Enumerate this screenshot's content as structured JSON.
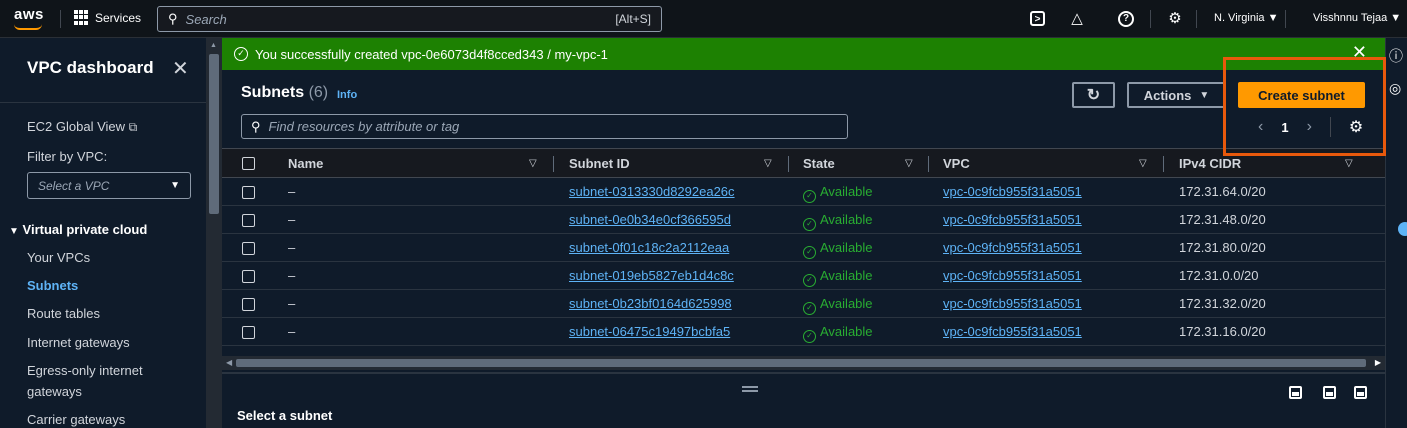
{
  "nav": {
    "logo": "aws",
    "services": "Services",
    "search_placeholder": "Search",
    "search_shortcut": "[Alt+S]",
    "region": "N. Virginia ▼",
    "user": "Visshnnu Tejaa ▼",
    "icons": [
      "cloudshell-icon",
      "bell-icon",
      "help-icon",
      "gear-icon"
    ]
  },
  "sidebar": {
    "title": "VPC dashboard",
    "ec2_global": "EC2 Global View",
    "filter_label": "Filter by VPC:",
    "filter_placeholder": "Select a VPC",
    "section": "Virtual private cloud",
    "items": [
      {
        "label": "Your VPCs",
        "active": false
      },
      {
        "label": "Subnets",
        "active": true
      },
      {
        "label": "Route tables",
        "active": false
      },
      {
        "label": "Internet gateways",
        "active": false
      },
      {
        "label": "Egress-only internet",
        "active": false
      },
      {
        "label": "gateways",
        "active": false
      },
      {
        "label": "Carrier gateways",
        "active": false
      }
    ]
  },
  "flash": {
    "message": "You successfully created vpc-0e6073d4f8cced343 / my-vpc-1",
    "color": "#1d8102"
  },
  "header": {
    "title": "Subnets",
    "count": "(6)",
    "info": "Info",
    "actions": "Actions",
    "create": "Create subnet",
    "filter_placeholder": "Find resources by attribute or tag",
    "page": "1"
  },
  "table": {
    "columns": [
      "Name",
      "Subnet ID",
      "State",
      "VPC",
      "IPv4 CIDR"
    ],
    "rows": [
      {
        "name": "–",
        "subnet_id": "subnet-0313330d8292ea26c",
        "state": "Available",
        "vpc": "vpc-0c9fcb955f31a5051",
        "cidr": "172.31.64.0/20"
      },
      {
        "name": "–",
        "subnet_id": "subnet-0e0b34e0cf366595d",
        "state": "Available",
        "vpc": "vpc-0c9fcb955f31a5051",
        "cidr": "172.31.48.0/20"
      },
      {
        "name": "–",
        "subnet_id": "subnet-0f01c18c2a2112eaa",
        "state": "Available",
        "vpc": "vpc-0c9fcb955f31a5051",
        "cidr": "172.31.80.0/20"
      },
      {
        "name": "–",
        "subnet_id": "subnet-019eb5827eb1d4c8c",
        "state": "Available",
        "vpc": "vpc-0c9fcb955f31a5051",
        "cidr": "172.31.0.0/20"
      },
      {
        "name": "–",
        "subnet_id": "subnet-0b23bf0164d625998",
        "state": "Available",
        "vpc": "vpc-0c9fcb955f31a5051",
        "cidr": "172.31.32.0/20"
      },
      {
        "name": "–",
        "subnet_id": "subnet-06475c19497bcbfa5",
        "state": "Available",
        "vpc": "vpc-0c9fcb955f31a5051",
        "cidr": "172.31.16.0/20"
      }
    ]
  },
  "split_panel": {
    "title": "Select a subnet"
  },
  "colors": {
    "accent": "#ff9900",
    "link": "#5eb3f6",
    "success": "#29ad32",
    "highlight": "#e8590c"
  }
}
